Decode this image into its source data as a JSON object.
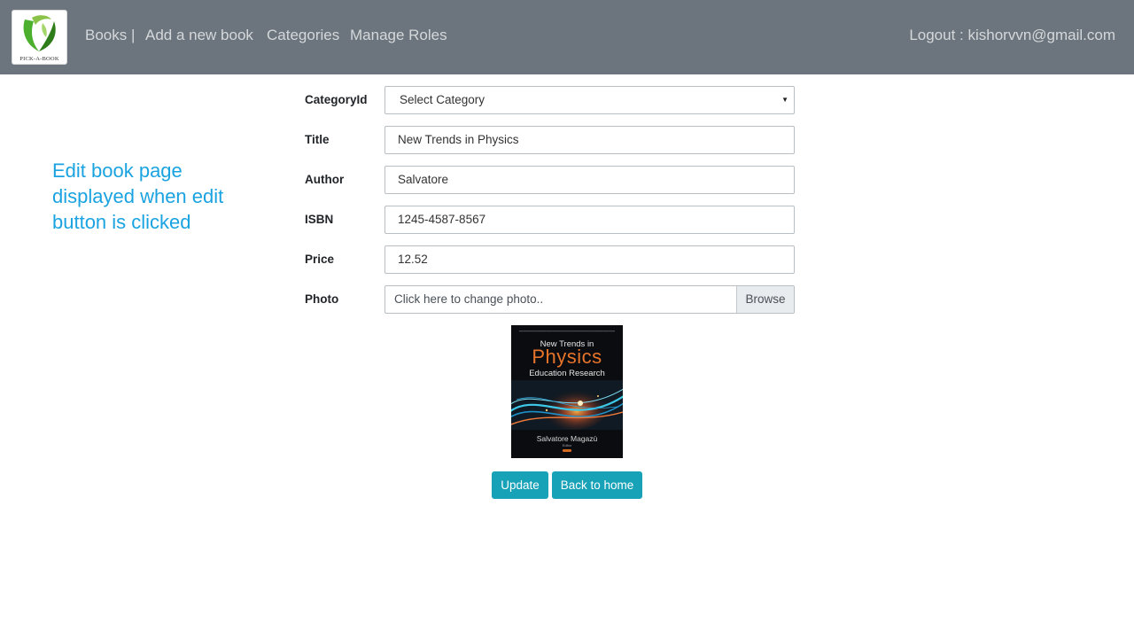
{
  "brand": {
    "logo_text": "PICK-A-BOOK"
  },
  "nav": {
    "books": "Books |",
    "add_book": "Add a new book",
    "categories": "Categories",
    "manage_roles": "Manage Roles",
    "logout": "Logout : kishorvvn@gmail.com"
  },
  "annotation": "Edit book page displayed when edit button is clicked",
  "form": {
    "category": {
      "label": "CategoryId",
      "value": "Select Category"
    },
    "title": {
      "label": "Title",
      "value": "New Trends in Physics"
    },
    "author": {
      "label": "Author",
      "value": "Salvatore"
    },
    "isbn": {
      "label": "ISBN",
      "value": "1245-4587-8567"
    },
    "price": {
      "label": "Price",
      "value": "12.52"
    },
    "photo": {
      "label": "Photo",
      "placeholder": "Click here to change photo..",
      "browse": "Browse"
    }
  },
  "cover": {
    "line1": "New Trends in",
    "line2": "Physics",
    "line3": "Education Research",
    "editor": "Salvatore Magazù",
    "role": "Editor"
  },
  "buttons": {
    "update": "Update",
    "back": "Back to home"
  },
  "colors": {
    "navbar": "#6c757d",
    "nav_text": "#d5d8db",
    "annotation": "#1aa3e0",
    "button": "#17a2b8",
    "cover_title": "#e8742a"
  }
}
